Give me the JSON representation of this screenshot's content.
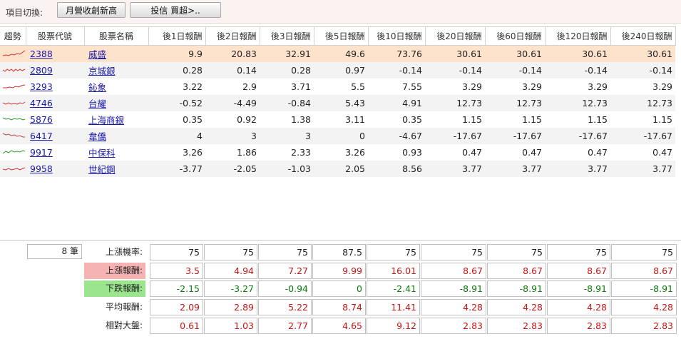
{
  "toolbar": {
    "label": "項目切換:",
    "button1": "月營收創新高",
    "button2": "投信 買超>.."
  },
  "colors": {
    "selected_row": "#fde2cc",
    "positive": "#c81414",
    "negative": "#0c7a0c",
    "up_label_bg": "#f6b3b3",
    "down_label_bg": "#9be58f"
  },
  "table": {
    "headers": [
      "趨勢",
      "股票代號",
      "股票名稱",
      "後1日報酬",
      "後2日報酬",
      "後3日報酬",
      "後5日報酬",
      "後10日報酬",
      "後20日報酬",
      "後60日報酬",
      "後120日報酬",
      "後240日報酬"
    ],
    "rows": [
      {
        "code": "2388",
        "name": "威盛",
        "vals": [
          "9.9",
          "20.83",
          "32.91",
          "49.6",
          "73.76",
          "30.61",
          "30.61",
          "30.61",
          "30.61"
        ]
      },
      {
        "code": "2809",
        "name": "京城銀",
        "vals": [
          "0.28",
          "0.14",
          "0.28",
          "0.97",
          "-0.14",
          "-0.14",
          "-0.14",
          "-0.14",
          "-0.14"
        ]
      },
      {
        "code": "3293",
        "name": "鈊象",
        "vals": [
          "3.22",
          "2.9",
          "3.71",
          "5.5",
          "7.55",
          "3.29",
          "3.29",
          "3.29",
          "3.29"
        ]
      },
      {
        "code": "4746",
        "name": "台耀",
        "vals": [
          "-0.52",
          "-4.49",
          "-0.84",
          "5.43",
          "4.91",
          "12.73",
          "12.73",
          "12.73",
          "12.73"
        ]
      },
      {
        "code": "5876",
        "name": "上海商銀",
        "vals": [
          "0.35",
          "0.92",
          "1.38",
          "3.11",
          "0.35",
          "1.15",
          "1.15",
          "1.15",
          "1.15"
        ]
      },
      {
        "code": "6417",
        "name": "韋僑",
        "vals": [
          "4",
          "3",
          "3",
          "0",
          "-4.67",
          "-17.67",
          "-17.67",
          "-17.67",
          "-17.67"
        ]
      },
      {
        "code": "9917",
        "name": "中保科",
        "vals": [
          "3.26",
          "1.86",
          "2.33",
          "3.26",
          "0.93",
          "0.47",
          "0.47",
          "0.47",
          "0.47"
        ]
      },
      {
        "code": "9958",
        "name": "世紀鋼",
        "vals": [
          "-3.77",
          "-2.05",
          "-1.03",
          "2.05",
          "8.56",
          "3.77",
          "3.77",
          "3.77",
          "3.77"
        ]
      }
    ]
  },
  "summary": {
    "count": "8 筆",
    "rows": [
      {
        "label": "上漲機率:",
        "style": "plain",
        "vals": [
          "75",
          "75",
          "75",
          "87.5",
          "75",
          "75",
          "75",
          "75",
          "75"
        ]
      },
      {
        "label": "上漲報酬:",
        "style": "red",
        "vals": [
          "3.5",
          "4.94",
          "7.27",
          "9.99",
          "16.01",
          "8.67",
          "8.67",
          "8.67",
          "8.67"
        ]
      },
      {
        "label": "下跌報酬:",
        "style": "green",
        "vals": [
          "-2.15",
          "-3.27",
          "-0.94",
          "0",
          "-2.41",
          "-8.91",
          "-8.91",
          "-8.91",
          "-8.91"
        ]
      },
      {
        "label": "平均報酬:",
        "style": "plain",
        "vals": [
          "2.09",
          "2.89",
          "5.22",
          "8.74",
          "11.41",
          "4.28",
          "4.28",
          "4.28",
          "4.28"
        ]
      },
      {
        "label": "相對大盤:",
        "style": "plain",
        "vals": [
          "0.61",
          "1.03",
          "2.77",
          "4.65",
          "9.12",
          "2.83",
          "2.83",
          "2.83",
          "2.83"
        ]
      }
    ]
  }
}
